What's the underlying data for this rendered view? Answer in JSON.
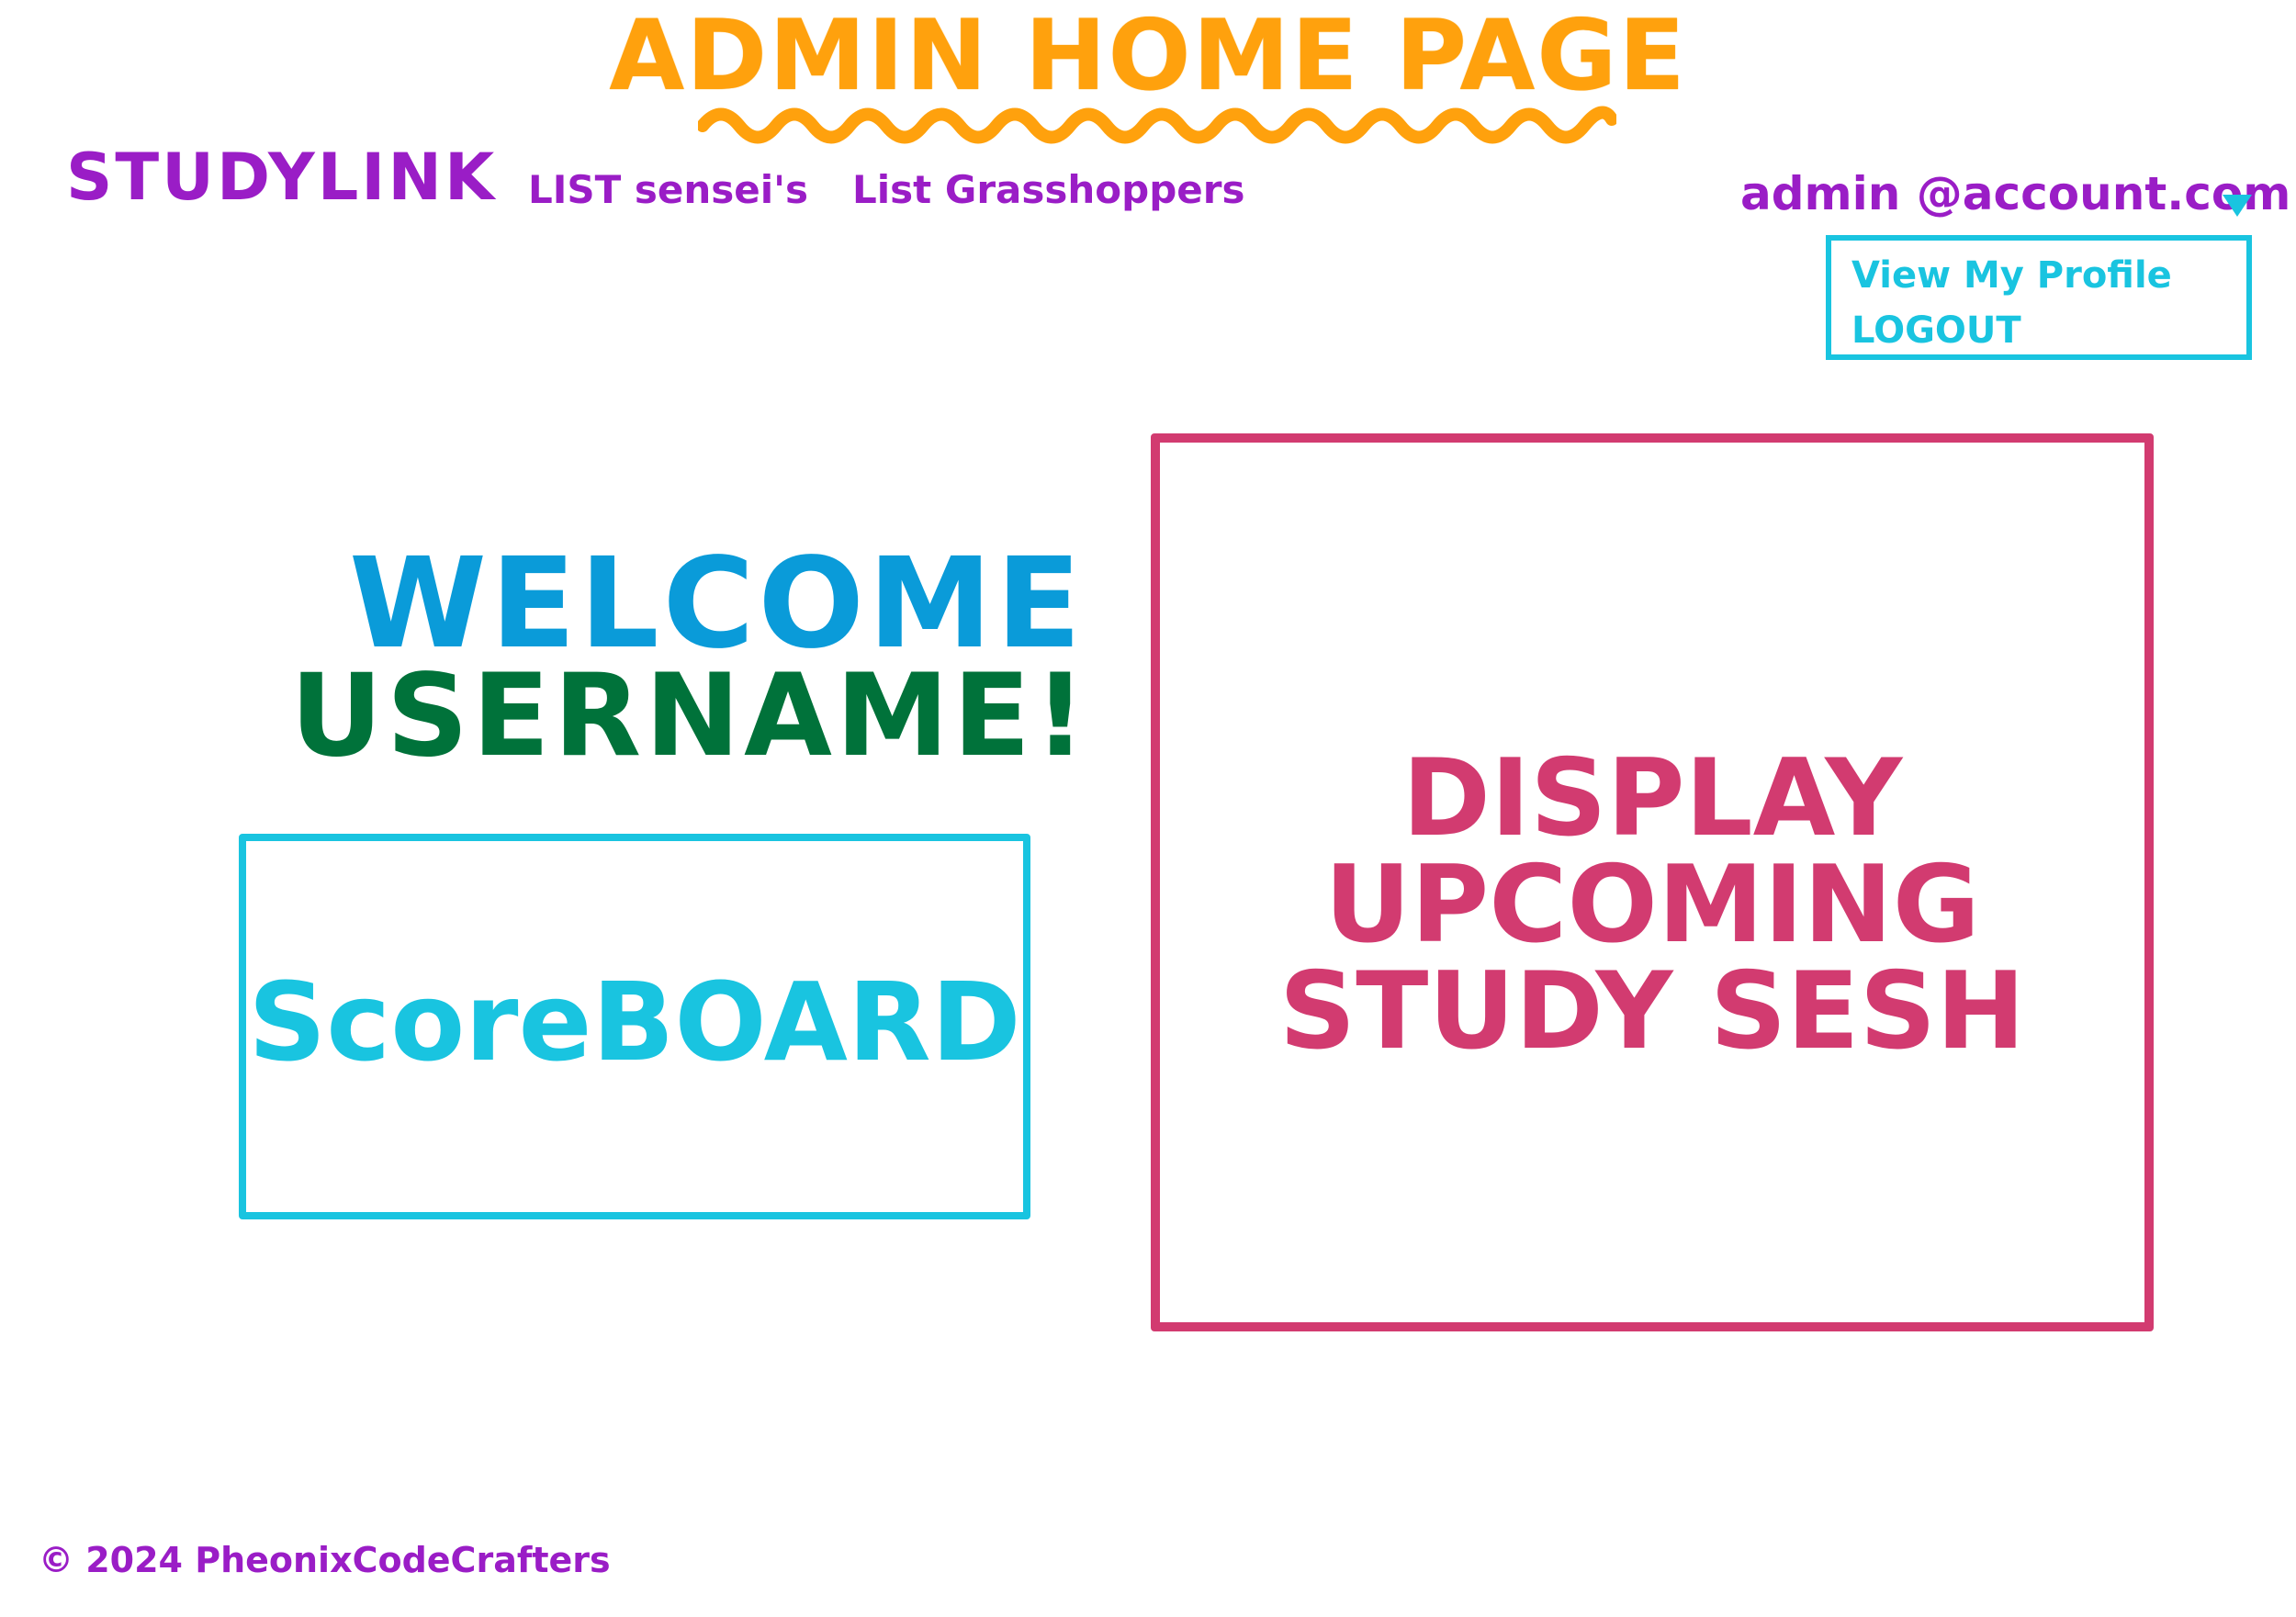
{
  "header": {
    "page_title": "ADMIN HOME PAGE"
  },
  "nav": {
    "brand": "STUDYLINK",
    "links": [
      {
        "label": "LIST sensei's"
      },
      {
        "label": "List Grasshoppers"
      }
    ]
  },
  "account": {
    "email": "admin @account.com",
    "caret_icon": "triangle-down",
    "menu": [
      {
        "label": "View My Profile"
      },
      {
        "label": "LOGOUT"
      }
    ]
  },
  "welcome": {
    "line1": "WELCOME",
    "line2": "USERNAME!"
  },
  "scoreboard": {
    "label": "ScoreBOARD"
  },
  "upcoming": {
    "lines": [
      "DISPLAY",
      "UPCOMING",
      "STUDY SESH"
    ]
  },
  "footer": {
    "copyright": "© 2024 PheonixCodeCrafters"
  },
  "colors": {
    "title": "#ffa10d",
    "nav": "#9a1dc6",
    "accent_cyan": "#19c4e0",
    "welcome_blue": "#0a9bd9",
    "welcome_green": "#00723a",
    "session_pink": "#d23b70"
  }
}
